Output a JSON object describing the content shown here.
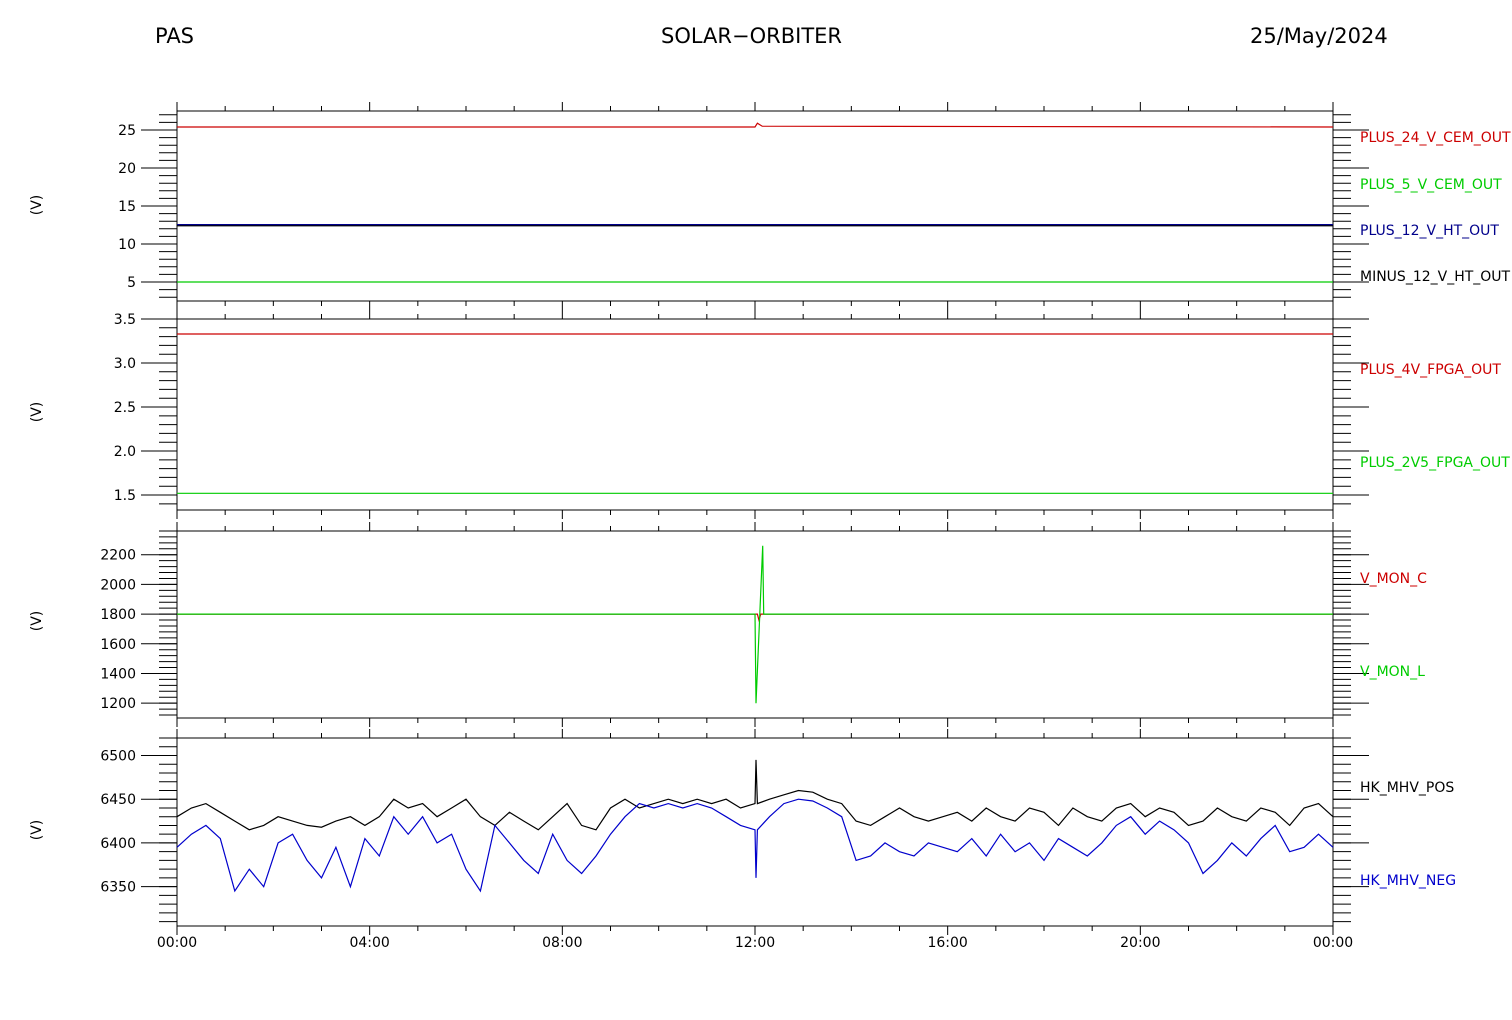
{
  "header": {
    "instrument": "PAS",
    "mission": "SOLAR−ORBITER",
    "date": "25/May/2024"
  },
  "chart_data": {
    "type": "line",
    "x_tick_labels": [
      "00:00",
      "04:00",
      "08:00",
      "12:00",
      "16:00",
      "20:00",
      "00:00"
    ],
    "x_range_hours": [
      0,
      24
    ],
    "panels": [
      {
        "ylabel": "(V)",
        "ylim": [
          2.5,
          27.5
        ],
        "ytick_values": [
          5,
          10,
          15,
          20,
          25
        ],
        "ytick_labels": [
          "5",
          "10",
          "15",
          "20",
          "25"
        ],
        "series": [
          {
            "name": "PLUS_24_V_CEM_OUT",
            "color": "#cc0000",
            "points": [
              [
                0,
                25.4
              ],
              [
                12.0,
                25.4
              ],
              [
                12.05,
                25.9
              ],
              [
                12.15,
                25.5
              ],
              [
                24,
                25.4
              ]
            ]
          },
          {
            "name": "PLUS_5_V_CEM_OUT",
            "color": "#00cc00",
            "points": [
              [
                0,
                5.0
              ],
              [
                24,
                5.0
              ]
            ]
          },
          {
            "name": "PLUS_12_V_HT_OUT",
            "color": "#00008b",
            "points": [
              [
                0,
                12.5
              ],
              [
                24,
                12.5
              ]
            ]
          },
          {
            "name": "MINUS_12_V_HT_OUT",
            "color": "#000000",
            "points": [
              [
                0,
                12.4
              ],
              [
                24,
                12.4
              ]
            ]
          }
        ]
      },
      {
        "ylabel": "(V)",
        "ylim": [
          1.33,
          3.5
        ],
        "ytick_values": [
          1.5,
          2.0,
          2.5,
          3.0,
          3.5
        ],
        "ytick_labels": [
          "1.5",
          "2.0",
          "2.5",
          "3.0",
          "3.5"
        ],
        "series": [
          {
            "name": "PLUS_4V_FPGA_OUT",
            "color": "#cc0000",
            "points": [
              [
                0,
                3.33
              ],
              [
                24,
                3.33
              ]
            ]
          },
          {
            "name": "PLUS_2V5_FPGA_OUT",
            "color": "#00cc00",
            "points": [
              [
                0,
                1.52
              ],
              [
                24,
                1.52
              ]
            ]
          }
        ]
      },
      {
        "ylabel": "(V)",
        "ylim": [
          1100,
          2360
        ],
        "ytick_values": [
          1200,
          1400,
          1600,
          1800,
          2000,
          2200
        ],
        "ytick_labels": [
          "1200",
          "1400",
          "1600",
          "1800",
          "2000",
          "2200"
        ],
        "series": [
          {
            "name": "V_MON_C",
            "color": "#cc0000",
            "points": [
              [
                0,
                1800
              ],
              [
                12.05,
                1800
              ],
              [
                12.08,
                1760
              ],
              [
                12.12,
                1800
              ],
              [
                24,
                1800
              ]
            ]
          },
          {
            "name": "V_MON_L",
            "color": "#00cc00",
            "points": [
              [
                0,
                1800
              ],
              [
                12.0,
                1800
              ],
              [
                12.02,
                1200
              ],
              [
                12.16,
                2260
              ],
              [
                12.18,
                1800
              ],
              [
                24,
                1800
              ]
            ]
          }
        ]
      },
      {
        "ylabel": "(V)",
        "ylim": [
          6305,
          6520
        ],
        "ytick_values": [
          6350,
          6400,
          6450,
          6500
        ],
        "ytick_labels": [
          "6350",
          "6400",
          "6450",
          "6500"
        ],
        "series": [
          {
            "name": "HK_MHV_POS",
            "color": "#000000",
            "points": [
              [
                0,
                6430
              ],
              [
                0.3,
                6440
              ],
              [
                0.6,
                6445
              ],
              [
                0.9,
                6435
              ],
              [
                1.2,
                6425
              ],
              [
                1.5,
                6415
              ],
              [
                1.8,
                6420
              ],
              [
                2.1,
                6430
              ],
              [
                2.4,
                6425
              ],
              [
                2.7,
                6420
              ],
              [
                3.0,
                6418
              ],
              [
                3.3,
                6425
              ],
              [
                3.6,
                6430
              ],
              [
                3.9,
                6420
              ],
              [
                4.2,
                6430
              ],
              [
                4.5,
                6450
              ],
              [
                4.8,
                6440
              ],
              [
                5.1,
                6445
              ],
              [
                5.4,
                6430
              ],
              [
                5.7,
                6440
              ],
              [
                6.0,
                6450
              ],
              [
                6.3,
                6430
              ],
              [
                6.6,
                6420
              ],
              [
                6.9,
                6435
              ],
              [
                7.2,
                6425
              ],
              [
                7.5,
                6415
              ],
              [
                7.8,
                6430
              ],
              [
                8.1,
                6445
              ],
              [
                8.4,
                6420
              ],
              [
                8.7,
                6415
              ],
              [
                9.0,
                6440
              ],
              [
                9.3,
                6450
              ],
              [
                9.6,
                6440
              ],
              [
                9.9,
                6445
              ],
              [
                10.2,
                6450
              ],
              [
                10.5,
                6445
              ],
              [
                10.8,
                6450
              ],
              [
                11.1,
                6445
              ],
              [
                11.4,
                6450
              ],
              [
                11.7,
                6440
              ],
              [
                12.0,
                6445
              ],
              [
                12.02,
                6495
              ],
              [
                12.05,
                6445
              ],
              [
                12.3,
                6450
              ],
              [
                12.6,
                6455
              ],
              [
                12.9,
                6460
              ],
              [
                13.2,
                6458
              ],
              [
                13.5,
                6450
              ],
              [
                13.8,
                6445
              ],
              [
                14.1,
                6425
              ],
              [
                14.4,
                6420
              ],
              [
                14.7,
                6430
              ],
              [
                15.0,
                6440
              ],
              [
                15.3,
                6430
              ],
              [
                15.6,
                6425
              ],
              [
                15.9,
                6430
              ],
              [
                16.2,
                6435
              ],
              [
                16.5,
                6425
              ],
              [
                16.8,
                6440
              ],
              [
                17.1,
                6430
              ],
              [
                17.4,
                6425
              ],
              [
                17.7,
                6440
              ],
              [
                18.0,
                6435
              ],
              [
                18.3,
                6420
              ],
              [
                18.6,
                6440
              ],
              [
                18.9,
                6430
              ],
              [
                19.2,
                6425
              ],
              [
                19.5,
                6440
              ],
              [
                19.8,
                6445
              ],
              [
                20.1,
                6430
              ],
              [
                20.4,
                6440
              ],
              [
                20.7,
                6435
              ],
              [
                21.0,
                6420
              ],
              [
                21.3,
                6425
              ],
              [
                21.6,
                6440
              ],
              [
                21.9,
                6430
              ],
              [
                22.2,
                6425
              ],
              [
                22.5,
                6440
              ],
              [
                22.8,
                6435
              ],
              [
                23.1,
                6420
              ],
              [
                23.4,
                6440
              ],
              [
                23.7,
                6445
              ],
              [
                24.0,
                6430
              ]
            ]
          },
          {
            "name": "HK_MHV_NEG",
            "color": "#0000cc",
            "points": [
              [
                0,
                6395
              ],
              [
                0.3,
                6410
              ],
              [
                0.6,
                6420
              ],
              [
                0.9,
                6405
              ],
              [
                1.2,
                6345
              ],
              [
                1.5,
                6370
              ],
              [
                1.8,
                6350
              ],
              [
                2.1,
                6400
              ],
              [
                2.4,
                6410
              ],
              [
                2.7,
                6380
              ],
              [
                3.0,
                6360
              ],
              [
                3.3,
                6395
              ],
              [
                3.6,
                6350
              ],
              [
                3.9,
                6405
              ],
              [
                4.2,
                6385
              ],
              [
                4.5,
                6430
              ],
              [
                4.8,
                6410
              ],
              [
                5.1,
                6430
              ],
              [
                5.4,
                6400
              ],
              [
                5.7,
                6410
              ],
              [
                6.0,
                6370
              ],
              [
                6.3,
                6345
              ],
              [
                6.6,
                6420
              ],
              [
                6.9,
                6400
              ],
              [
                7.2,
                6380
              ],
              [
                7.5,
                6365
              ],
              [
                7.8,
                6410
              ],
              [
                8.1,
                6380
              ],
              [
                8.4,
                6365
              ],
              [
                8.7,
                6385
              ],
              [
                9.0,
                6410
              ],
              [
                9.3,
                6430
              ],
              [
                9.6,
                6445
              ],
              [
                9.9,
                6440
              ],
              [
                10.2,
                6445
              ],
              [
                10.5,
                6440
              ],
              [
                10.8,
                6445
              ],
              [
                11.1,
                6440
              ],
              [
                11.4,
                6430
              ],
              [
                11.7,
                6420
              ],
              [
                12.0,
                6415
              ],
              [
                12.02,
                6360
              ],
              [
                12.05,
                6415
              ],
              [
                12.3,
                6430
              ],
              [
                12.6,
                6445
              ],
              [
                12.9,
                6450
              ],
              [
                13.2,
                6448
              ],
              [
                13.5,
                6440
              ],
              [
                13.8,
                6430
              ],
              [
                14.1,
                6380
              ],
              [
                14.4,
                6385
              ],
              [
                14.7,
                6400
              ],
              [
                15.0,
                6390
              ],
              [
                15.3,
                6385
              ],
              [
                15.6,
                6400
              ],
              [
                15.9,
                6395
              ],
              [
                16.2,
                6390
              ],
              [
                16.5,
                6405
              ],
              [
                16.8,
                6385
              ],
              [
                17.1,
                6410
              ],
              [
                17.4,
                6390
              ],
              [
                17.7,
                6400
              ],
              [
                18.0,
                6380
              ],
              [
                18.3,
                6405
              ],
              [
                18.6,
                6395
              ],
              [
                18.9,
                6385
              ],
              [
                19.2,
                6400
              ],
              [
                19.5,
                6420
              ],
              [
                19.8,
                6430
              ],
              [
                20.1,
                6410
              ],
              [
                20.4,
                6425
              ],
              [
                20.7,
                6415
              ],
              [
                21.0,
                6400
              ],
              [
                21.3,
                6365
              ],
              [
                21.6,
                6380
              ],
              [
                21.9,
                6400
              ],
              [
                22.2,
                6385
              ],
              [
                22.5,
                6405
              ],
              [
                22.8,
                6420
              ],
              [
                23.1,
                6390
              ],
              [
                23.4,
                6395
              ],
              [
                23.7,
                6410
              ],
              [
                24.0,
                6395
              ]
            ]
          }
        ]
      }
    ]
  }
}
